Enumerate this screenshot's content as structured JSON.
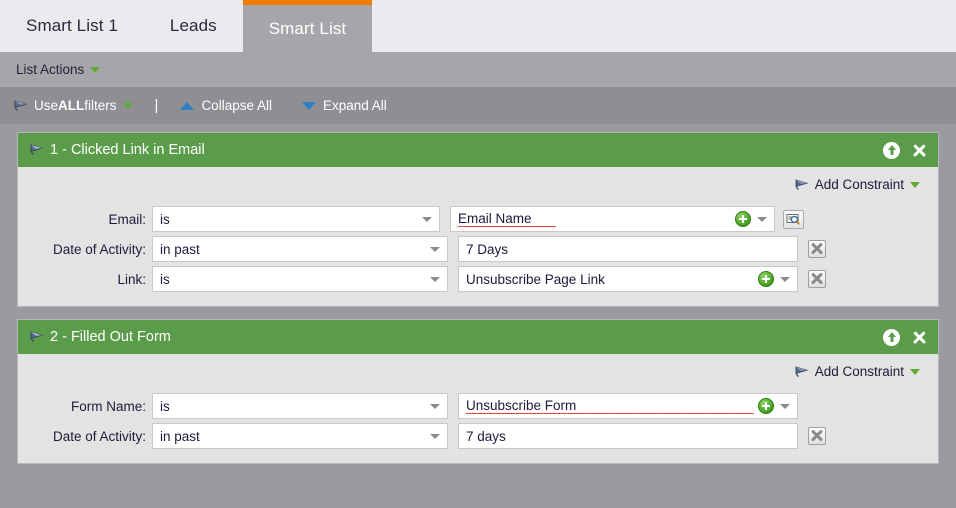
{
  "tabs": [
    {
      "label": "Smart List 1",
      "active": false,
      "name": "tab-smart-list-1"
    },
    {
      "label": "Leads",
      "active": false,
      "name": "tab-leads"
    },
    {
      "label": "Smart List",
      "active": true,
      "name": "tab-smart-list"
    }
  ],
  "actions_bar": {
    "list_actions_label": "List Actions",
    "dropdown_icon": "caret-down-icon"
  },
  "filter_toolbar": {
    "funnel_icon": "funnel-icon",
    "use_prefix": "Use ",
    "use_strong": "ALL",
    "use_suffix": " filters",
    "dropdown_icon": "caret-down-icon",
    "separator": "|",
    "collapse_all": "Collapse All",
    "collapse_icon": "triangle-up-icon",
    "expand_all": "Expand All",
    "expand_icon": "triangle-down-icon"
  },
  "colors": {
    "accent_orange": "#ef7d00",
    "block_green": "#5b9c4a",
    "toolbar_gray": "#8e8e93",
    "actions_gray": "#a6a6aa",
    "tab_bar": "#eceaee",
    "panel_bg": "#e3e3e3",
    "link_blue": "#2e7fc4",
    "plus_green": "#4aa524",
    "spellcheck_red": "#d21f0f"
  },
  "blocks": [
    {
      "title": "1 - Clicked Link in Email",
      "funnel_icon": "funnel-icon",
      "move_icon": "move-up-icon",
      "close_icon": "close-icon",
      "add_constraint": {
        "label": "Add Constraint",
        "funnel_icon": "funnel-icon",
        "dropdown_icon": "caret-down-icon"
      },
      "rows": [
        {
          "label": "Email:",
          "operator": "is",
          "value": "Email Name",
          "spellcheck": true,
          "has_plus": true,
          "value_has_caret": true,
          "trailing": "lookup",
          "select_width": "narrow",
          "value_width": "short"
        },
        {
          "label": "Date of Activity:",
          "operator": "in past",
          "value": "7 Days",
          "spellcheck": false,
          "has_plus": false,
          "value_has_caret": false,
          "trailing": "delete",
          "select_width": "wide",
          "value_width": "normal"
        },
        {
          "label": "Link:",
          "operator": "is",
          "value": "Unsubscribe Page Link",
          "spellcheck": false,
          "has_plus": true,
          "value_has_caret": true,
          "trailing": "delete",
          "select_width": "wide",
          "value_width": "normal"
        }
      ]
    },
    {
      "title": "2 - Filled Out Form",
      "funnel_icon": "funnel-icon",
      "move_icon": "move-up-icon",
      "close_icon": "close-icon",
      "add_constraint": {
        "label": "Add Constraint",
        "funnel_icon": "funnel-icon",
        "dropdown_icon": "caret-down-icon"
      },
      "rows": [
        {
          "label": "Form Name:",
          "operator": "is",
          "value": "Unsubscribe Form",
          "spellcheck": true,
          "has_plus": true,
          "value_has_caret": true,
          "trailing": "none",
          "select_width": "wide",
          "value_width": "normal"
        },
        {
          "label": "Date of Activity:",
          "operator": "in past",
          "value": "7 days",
          "spellcheck": false,
          "has_plus": false,
          "value_has_caret": false,
          "trailing": "delete",
          "select_width": "wide",
          "value_width": "normal"
        }
      ]
    }
  ]
}
